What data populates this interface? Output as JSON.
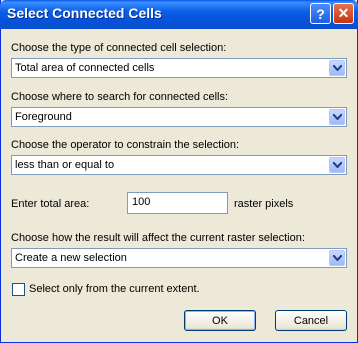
{
  "window": {
    "title": "Select Connected Cells"
  },
  "type_section": {
    "label": "Choose the type of connected cell selection:",
    "value": "Total area of connected cells"
  },
  "search_section": {
    "label": "Choose where to search for connected cells:",
    "value": "Foreground"
  },
  "operator_section": {
    "label": "Choose the operator to constrain the selection:",
    "value": "less than or equal to"
  },
  "area": {
    "label": "Enter total area:",
    "value": "100",
    "unit": "raster pixels"
  },
  "result_section": {
    "label": "Choose how the result will affect the current raster selection:",
    "value": "Create a new selection"
  },
  "extent": {
    "label": "Select only from the current extent.",
    "checked": false
  },
  "buttons": {
    "ok": "OK",
    "cancel": "Cancel"
  },
  "icons": {
    "help": "?",
    "close": "✕"
  },
  "colors": {
    "title_bar": "#0553d9",
    "window_bg": "#ece9d8",
    "border": "#7f9db9"
  }
}
